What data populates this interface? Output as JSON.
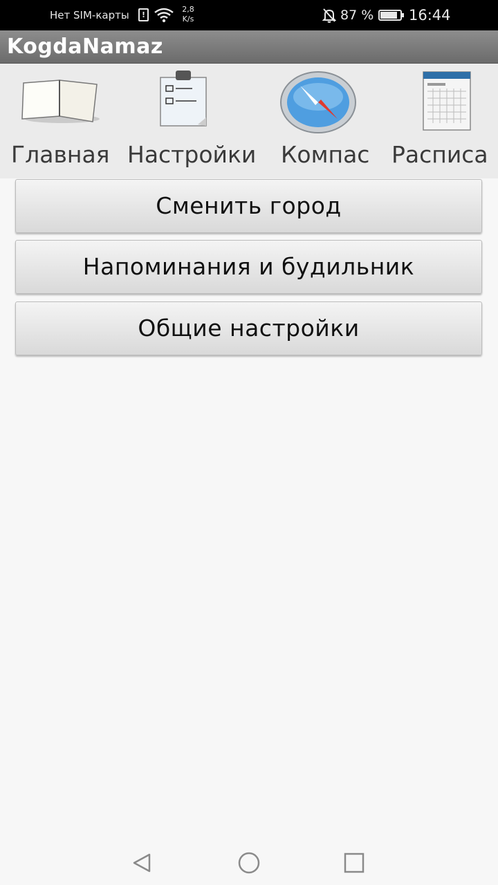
{
  "status_bar": {
    "carrier": "Нет SIM-карты",
    "sim_icon_char": "!",
    "net_speed_value": "2,8",
    "net_speed_unit": "K/s",
    "battery_percent": "87 %",
    "time": "16:44"
  },
  "app": {
    "title": "KogdaNamaz"
  },
  "tabs": [
    {
      "label": "Главная",
      "icon": "book-icon"
    },
    {
      "label": "Настройки",
      "icon": "clipboard-icon"
    },
    {
      "label": "Компас",
      "icon": "compass-icon"
    },
    {
      "label": "Расписа",
      "icon": "calendar-icon"
    }
  ],
  "buttons": {
    "change_city": "Сменить город",
    "reminders_alarm": "Напоминания и будильник",
    "general_settings": "Общие настройки"
  },
  "nav_bar": {
    "back": "back-icon",
    "home": "home-icon",
    "recents": "recents-icon"
  },
  "colors": {
    "title_bar": "#7a7a7a",
    "tab_strip": "#ebebeb",
    "background": "#f7f7f7",
    "status_bar": "#000000"
  }
}
